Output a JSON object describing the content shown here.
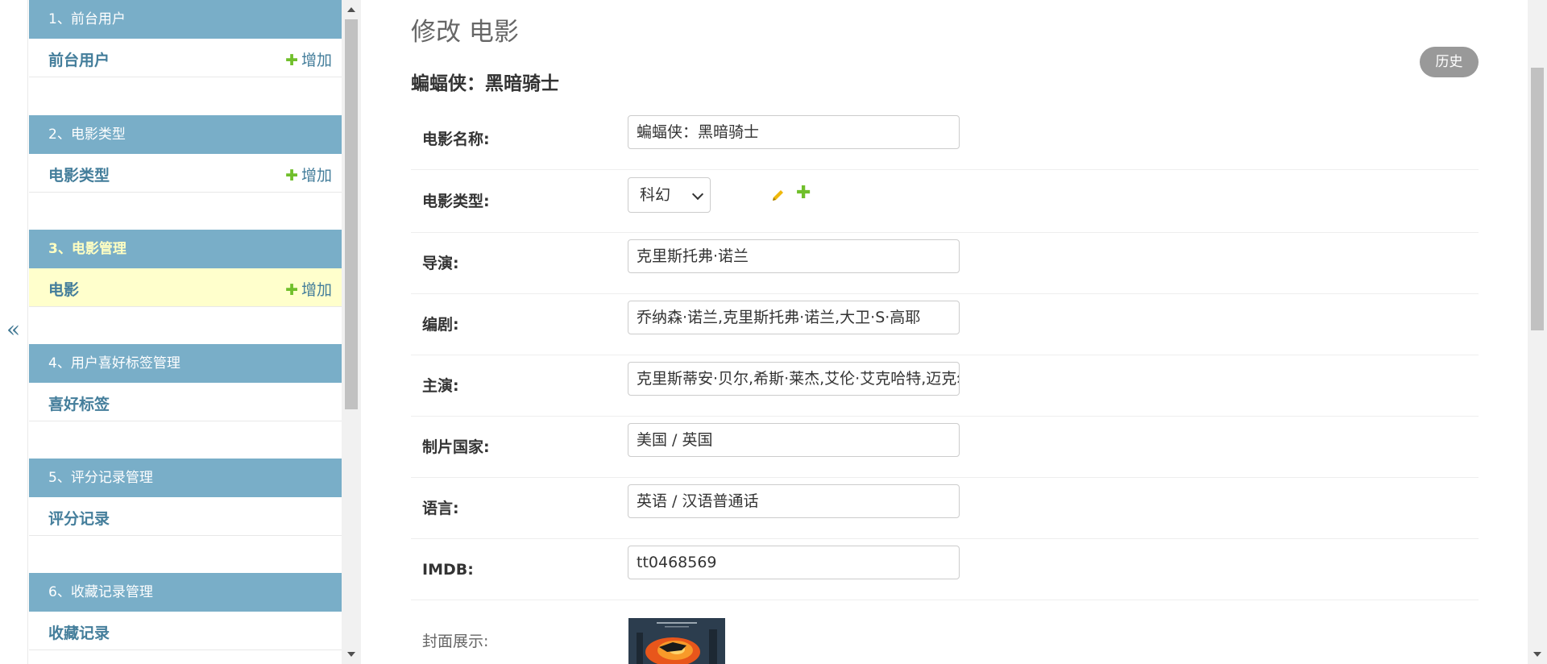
{
  "sidebar": {
    "collapse_glyph": "«",
    "modules": [
      {
        "caption": "1、前台用户",
        "link": "前台用户",
        "add": "增加"
      },
      {
        "caption": "2、电影类型",
        "link": "电影类型",
        "add": "增加"
      },
      {
        "caption": "3、电影管理",
        "link": "电影",
        "add": "增加",
        "current": true
      },
      {
        "caption": "4、用户喜好标签管理",
        "link": "喜好标签"
      },
      {
        "caption": "5、评分记录管理",
        "link": "评分记录"
      },
      {
        "caption": "6、收藏记录管理",
        "link": "收藏记录"
      }
    ]
  },
  "main": {
    "page_title": "修改 电影",
    "history_label": "历史",
    "object_title": "蝙蝠侠：黑暗骑士",
    "fields": {
      "name": {
        "label": "电影名称:",
        "value": "蝙蝠侠：黑暗骑士"
      },
      "genre": {
        "label": "电影类型:",
        "value": "科幻"
      },
      "director": {
        "label": "导演:",
        "value": "克里斯托弗·诺兰"
      },
      "writer": {
        "label": "编剧:",
        "value": "乔纳森·诺兰,克里斯托弗·诺兰,大卫·S·高耶"
      },
      "cast": {
        "label": "主演:",
        "value": "克里斯蒂安·贝尔,希斯·莱杰,艾伦·艾克哈特,迈克尔·凯恩"
      },
      "country": {
        "label": "制片国家:",
        "value": "美国 / 英国"
      },
      "language": {
        "label": "语言:",
        "value": "英语 / 汉语普通话"
      },
      "imdb": {
        "label": "IMDB:",
        "value": "tt0468569"
      },
      "cover": {
        "label": "封面展示:"
      }
    }
  },
  "colors": {
    "module_header": "#79aec8",
    "link": "#447e9b",
    "add_plus": "#70bf2b",
    "current_row": "#ffffcc",
    "history_button": "#999999"
  },
  "icons": [
    "collapse-icon",
    "plus-icon",
    "pencil-icon",
    "add-related-icon"
  ]
}
